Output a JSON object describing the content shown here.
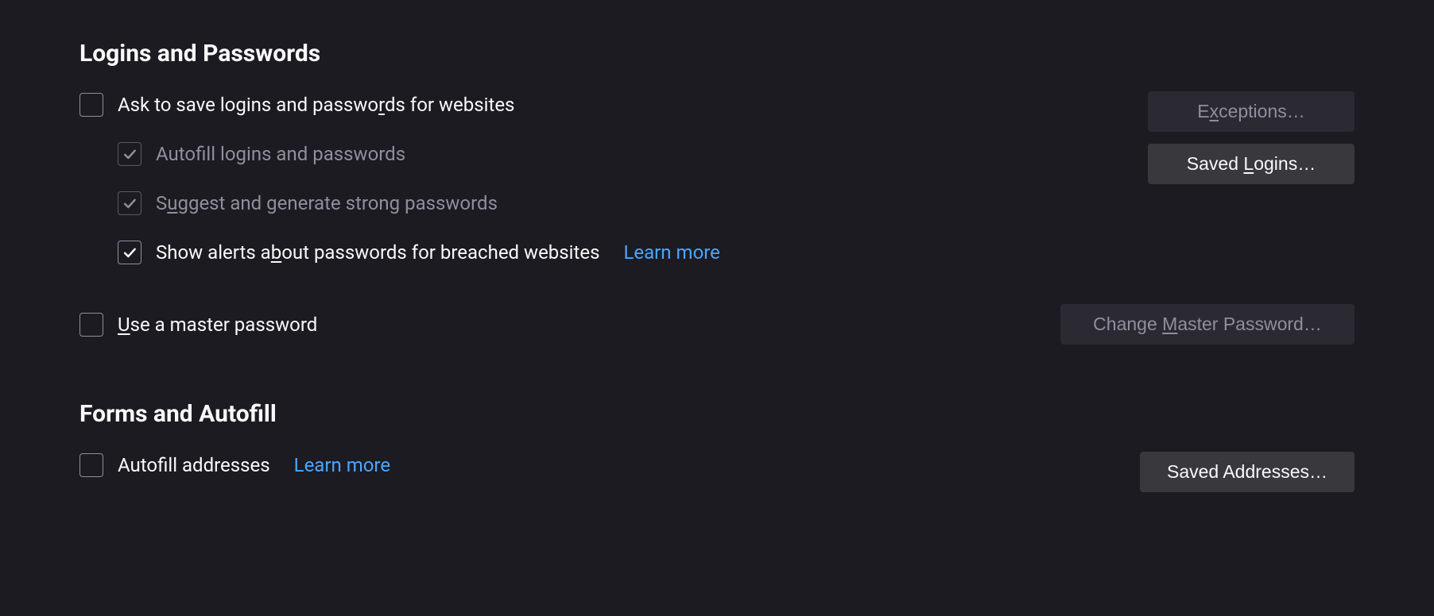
{
  "logins": {
    "heading": "Logins and Passwords",
    "ask_save_pre": "Ask to save logins and passwo",
    "ask_save_u": "r",
    "ask_save_post": "ds for websites",
    "autofill_pre": "Autof",
    "autofill_u": "i",
    "autofill_post": "ll logins and passwords",
    "suggest_pre": "S",
    "suggest_u": "u",
    "suggest_post": "ggest and generate strong passwords",
    "alerts_pre": "Show alerts a",
    "alerts_u": "b",
    "alerts_post": "out passwords for breached websites",
    "learn_more": "Learn more",
    "master_pre": "",
    "master_u": "U",
    "master_post": "se a master password",
    "btn_exceptions_pre": "E",
    "btn_exceptions_u": "x",
    "btn_exceptions_post": "ceptions…",
    "btn_saved_pre": "Saved ",
    "btn_saved_u": "L",
    "btn_saved_post": "ogins…",
    "btn_change_pre": "Change ",
    "btn_change_u": "M",
    "btn_change_post": "aster Password…",
    "checked": {
      "ask_save": false,
      "autofill": true,
      "suggest": true,
      "alerts": true,
      "master": false
    }
  },
  "forms": {
    "heading": "Forms and Autofill",
    "autofill_addr": "Autofill addresses",
    "learn_more": "Learn more",
    "btn_saved_addr": "Saved Addresses…",
    "checked": {
      "autofill_addr": false
    }
  }
}
